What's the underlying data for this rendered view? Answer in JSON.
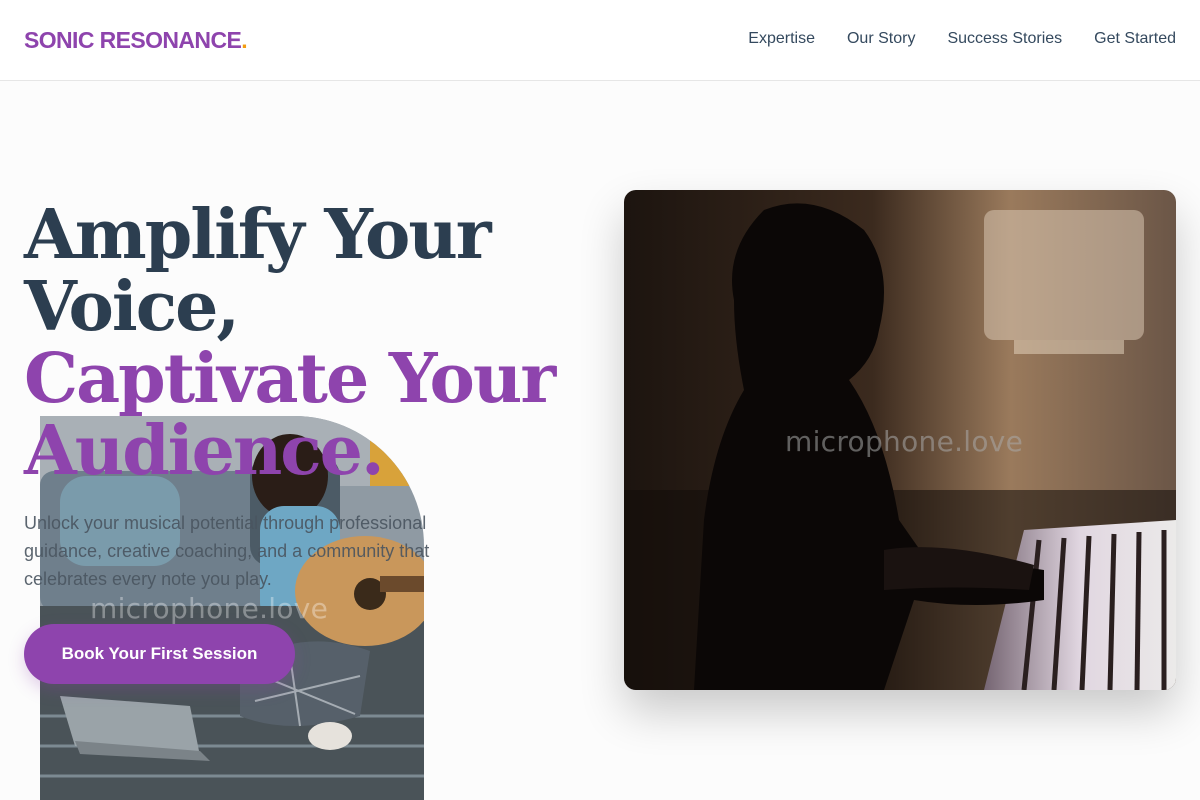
{
  "brand": {
    "name": "SONIC RESONANCE",
    "dot": ".",
    "color": "#8e44ad",
    "dot_color": "#f39c12"
  },
  "nav": {
    "items": [
      "Expertise",
      "Our Story",
      "Success Stories",
      "Get Started"
    ]
  },
  "hero": {
    "headline_line1": "Amplify Your",
    "headline_line2": "Voice,",
    "headline_line3": "Captivate Your",
    "headline_line4": "Audience.",
    "subtitle": "Unlock your musical potential through professional guidance, creative coaching, and a community that celebrates every note you play.",
    "cta_label": "Book Your First Session"
  },
  "images": {
    "guitar": {
      "watermark": "microphone.love",
      "alt": "Woman playing acoustic guitar with laptop"
    },
    "piano": {
      "watermark": "microphone.love",
      "alt": "Child playing piano in dim light"
    }
  },
  "colors": {
    "accent": "#8e44ad",
    "heading": "#2c3e50",
    "text": "#4a5560",
    "background": "#fcfcfc"
  }
}
